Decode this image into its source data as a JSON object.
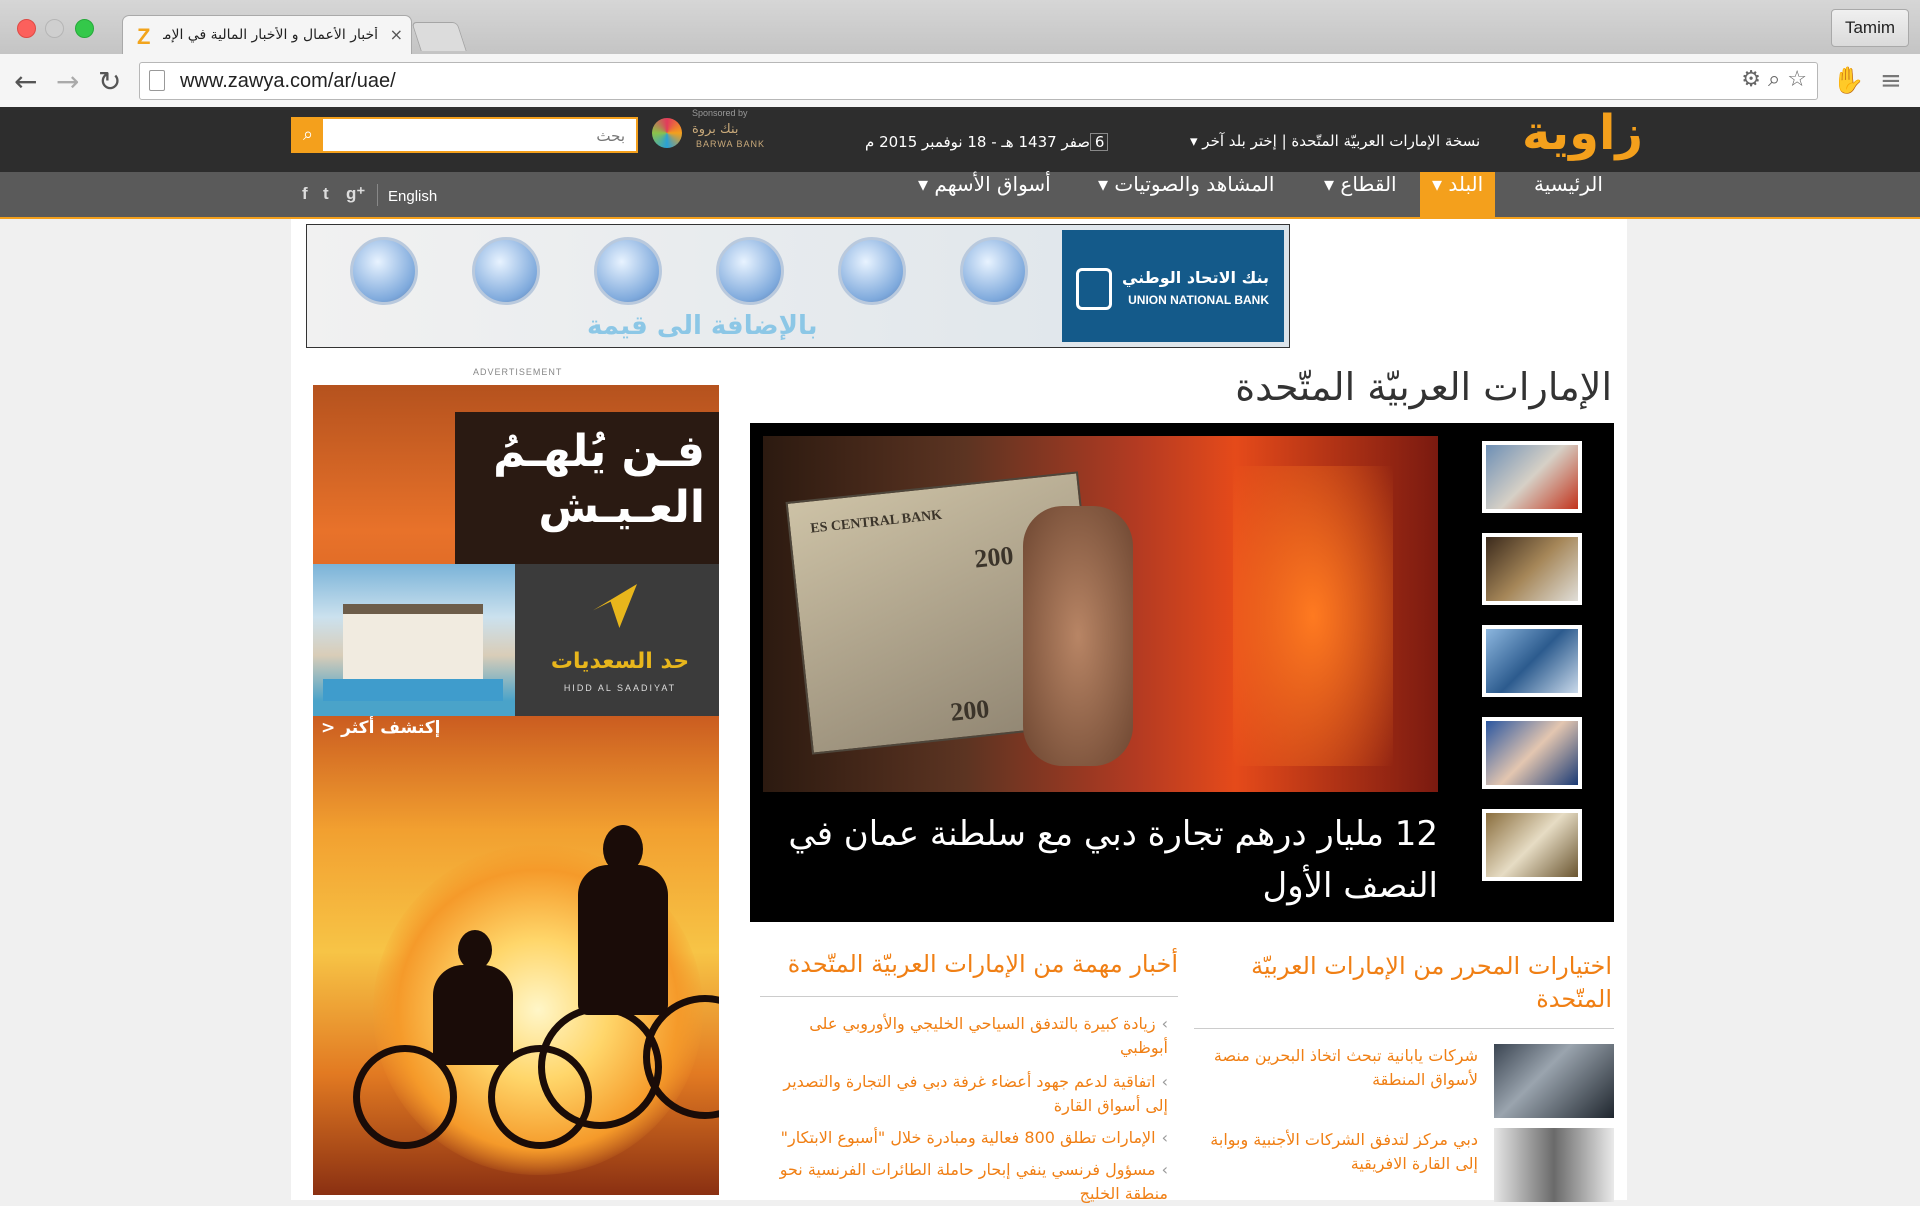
{
  "browser": {
    "tab_title": "أخبار الأعمال و الأخبار المالية في الإمارات",
    "tab_close": "×",
    "favicon": "Z",
    "profile_name": "Tamim",
    "url": "www.zawya.com/ar/uae/",
    "back_icon": "←",
    "forward_icon": "→",
    "reload_icon": "↻",
    "omnibox_icons": "⚙ ⌕ ☆",
    "ext_icon": "✋",
    "menu_icon": "≡"
  },
  "header": {
    "logo": "زاوية",
    "edition_text": "نسخة الإمارات العربيّة المتّحدة | إختر بلد آخر ▾",
    "date_text": "6 صفر 1437 هـ - 18 نوفمبر 2015 م",
    "sponsor_label": "Sponsored by",
    "sponsor_name_ar": "بنك بروة",
    "sponsor_name_en": "BARWA BANK",
    "search_placeholder": "بحث",
    "search_icon": "⌕"
  },
  "nav": {
    "items": [
      {
        "label": "الرئيسية"
      },
      {
        "label": "البلد ▾"
      },
      {
        "label": "القطاع ▾"
      },
      {
        "label": "المشاهد والصوتيات ▾"
      },
      {
        "label": "أسواق الأسهم ▾"
      }
    ],
    "english": "English",
    "social": [
      "f",
      "t",
      "g⁺"
    ]
  },
  "top_ad": {
    "tagline": "بالإضافة الى قيمة",
    "bank_ar": "بنك الاتحاد الوطني",
    "bank_en": "UNION NATIONAL BANK"
  },
  "side_ad": {
    "label": "ADVERTISEMENT",
    "headline_1": "فـن يُلهـمُ",
    "headline_2": "العـيـش",
    "brand_ar": "حد السعديات",
    "brand_en": "HIDD AL SAADIYAT",
    "cta": "إكتشف أكثر <"
  },
  "main": {
    "section_title": "الإمارات العربيّة المتّحدة",
    "featured_caption": "12 مليار درهم تجارة دبي مع سلطنة عمان في النصف الأول",
    "bill_text": "ES CENTRAL BANK",
    "bill_value": "200"
  },
  "editor_picks": {
    "title": "اختيارات المحرر من الإمارات العربيّة المتّحدة",
    "items": [
      {
        "text": "شركات يابانية تبحث اتخاذ البحرين منصة لأسواق المنطقة"
      },
      {
        "text": "دبي مركز لتدفق الشركات الأجنبية وبوابة إلى القارة الافريقية"
      }
    ]
  },
  "important_news": {
    "title": "أخبار مهمة من الإمارات العربيّة المتّحدة",
    "bullet": "›",
    "items": [
      {
        "text": "زيادة كبيرة بالتدفق السياحي الخليجي والأوروبي على أبوظبي"
      },
      {
        "text": "اتفاقية لدعم جهود أعضاء غرفة دبي في التجارة والتصدير إلى أسواق القارة"
      },
      {
        "text": "الإمارات تطلق 800 فعالية ومبادرة خلال \"أسبوع الابتكار\""
      },
      {
        "text": "مسؤول فرنسي ينفي إبحار حاملة الطائرات الفرنسية نحو منطقة الخليج"
      }
    ]
  },
  "colors": {
    "accent": "#f4a01c",
    "link": "#f07f14",
    "header_bg": "#2d2d2d",
    "nav_bg": "#5a5a5a"
  }
}
